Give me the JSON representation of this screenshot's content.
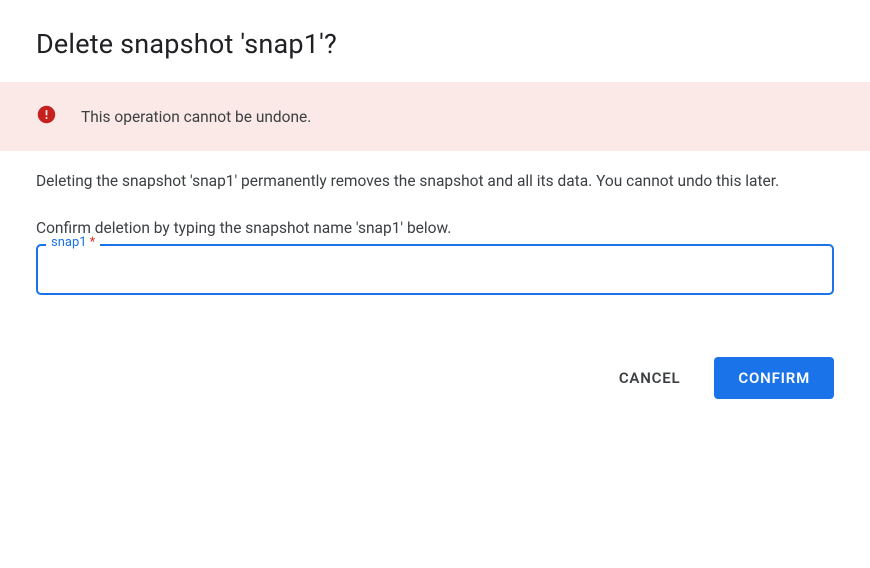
{
  "dialog": {
    "title": "Delete snapshot 'snap1'?",
    "warning": {
      "icon": "error-icon",
      "text": "This operation cannot be undone."
    },
    "description": "Deleting the snapshot 'snap1' permanently removes the snapshot and all its data. You cannot undo this later.",
    "instruction": "Confirm deletion by typing the snapshot name 'snap1' below.",
    "field": {
      "label": "snap1",
      "required_marker": "*",
      "value": ""
    },
    "actions": {
      "cancel_label": "Cancel",
      "confirm_label": "Confirm"
    }
  },
  "colors": {
    "primary": "#1a73e8",
    "error": "#c5221f",
    "warning_bg": "#fbe9e7"
  }
}
